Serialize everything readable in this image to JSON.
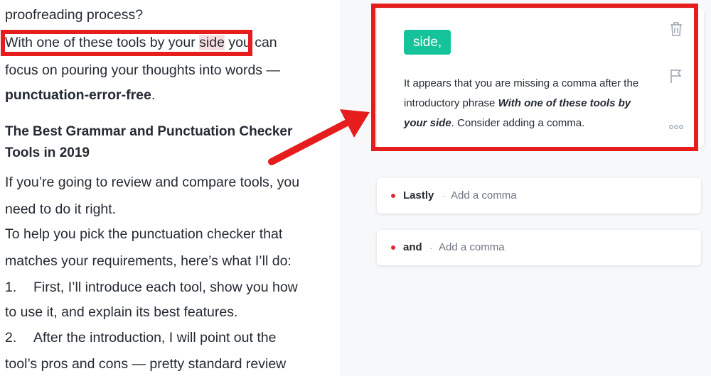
{
  "document": {
    "lines": [
      "proofreading process?",
      "With one of these tools by your ",
      "side",
      " you can",
      "focus on pouring your thoughts into words —",
      "punctuation-error-free",
      ".",
      "The Best Grammar and Punctuation Checker",
      "Tools in 2019",
      "If you’re going to review and compare tools, you",
      "need to do it right.",
      "To help you pick the punctuation checker that",
      "matches your requirements, here’s what I’ll do:",
      "First, I’ll introduce each tool, show you how",
      "to use it, and explain its best features.",
      "After the introduction, I will point out the",
      "tool’s pros and cons — pretty standard review"
    ],
    "list_numbers": [
      "1.",
      "2."
    ]
  },
  "suggestion": {
    "chip": "side,",
    "text_before": "It appears that you are missing a comma after the introductory phrase ",
    "phrase": "With one of these tools by your side",
    "text_after": ". Consider adding a comma.",
    "icons": [
      "trash-icon",
      "flag-icon",
      "more-icon"
    ]
  },
  "alerts": [
    {
      "word": "Lastly",
      "separator": "·",
      "action": "Add a comma"
    },
    {
      "word": "and",
      "separator": "·",
      "action": "Add a comma"
    }
  ],
  "colors": {
    "accent_green": "#15c39a",
    "annotation_red": "#e51d1d",
    "alert_dot": "#e22a36",
    "highlight": "#f6dde0"
  }
}
